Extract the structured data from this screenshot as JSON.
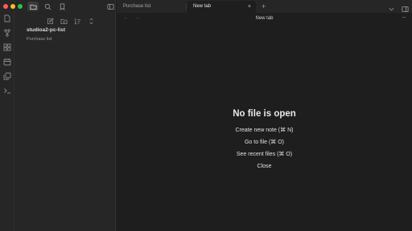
{
  "window": {
    "traffic_lights": {
      "close": "#ff5f57",
      "minimize": "#febc2e",
      "maximize": "#28c840"
    }
  },
  "ribbon": {
    "icons": [
      "files-icon",
      "graph-icon",
      "canvas-icon",
      "calendar-icon",
      "copy-icon",
      "terminal-icon"
    ]
  },
  "sidebar": {
    "vault_name": "studioa2-pc-list",
    "files": [
      "Purchase list"
    ]
  },
  "tabs": [
    {
      "label": "Purchase list",
      "active": false
    },
    {
      "label": "New tab",
      "active": true,
      "close_glyph": "×"
    }
  ],
  "tab_add_glyph": "+",
  "view": {
    "title": "New tab",
    "back_glyph": "←",
    "forward_glyph": "→",
    "more_glyph": "···"
  },
  "empty_state": {
    "title": "No file is open",
    "actions": [
      "Create new note (⌘ N)",
      "Go to file (⌘ O)",
      "See recent files (⌘ O)",
      "Close"
    ]
  },
  "colors": {
    "background": "#1e1e1e",
    "sidebar": "#262626",
    "text": "#dadada",
    "muted": "#9a9a9a"
  }
}
